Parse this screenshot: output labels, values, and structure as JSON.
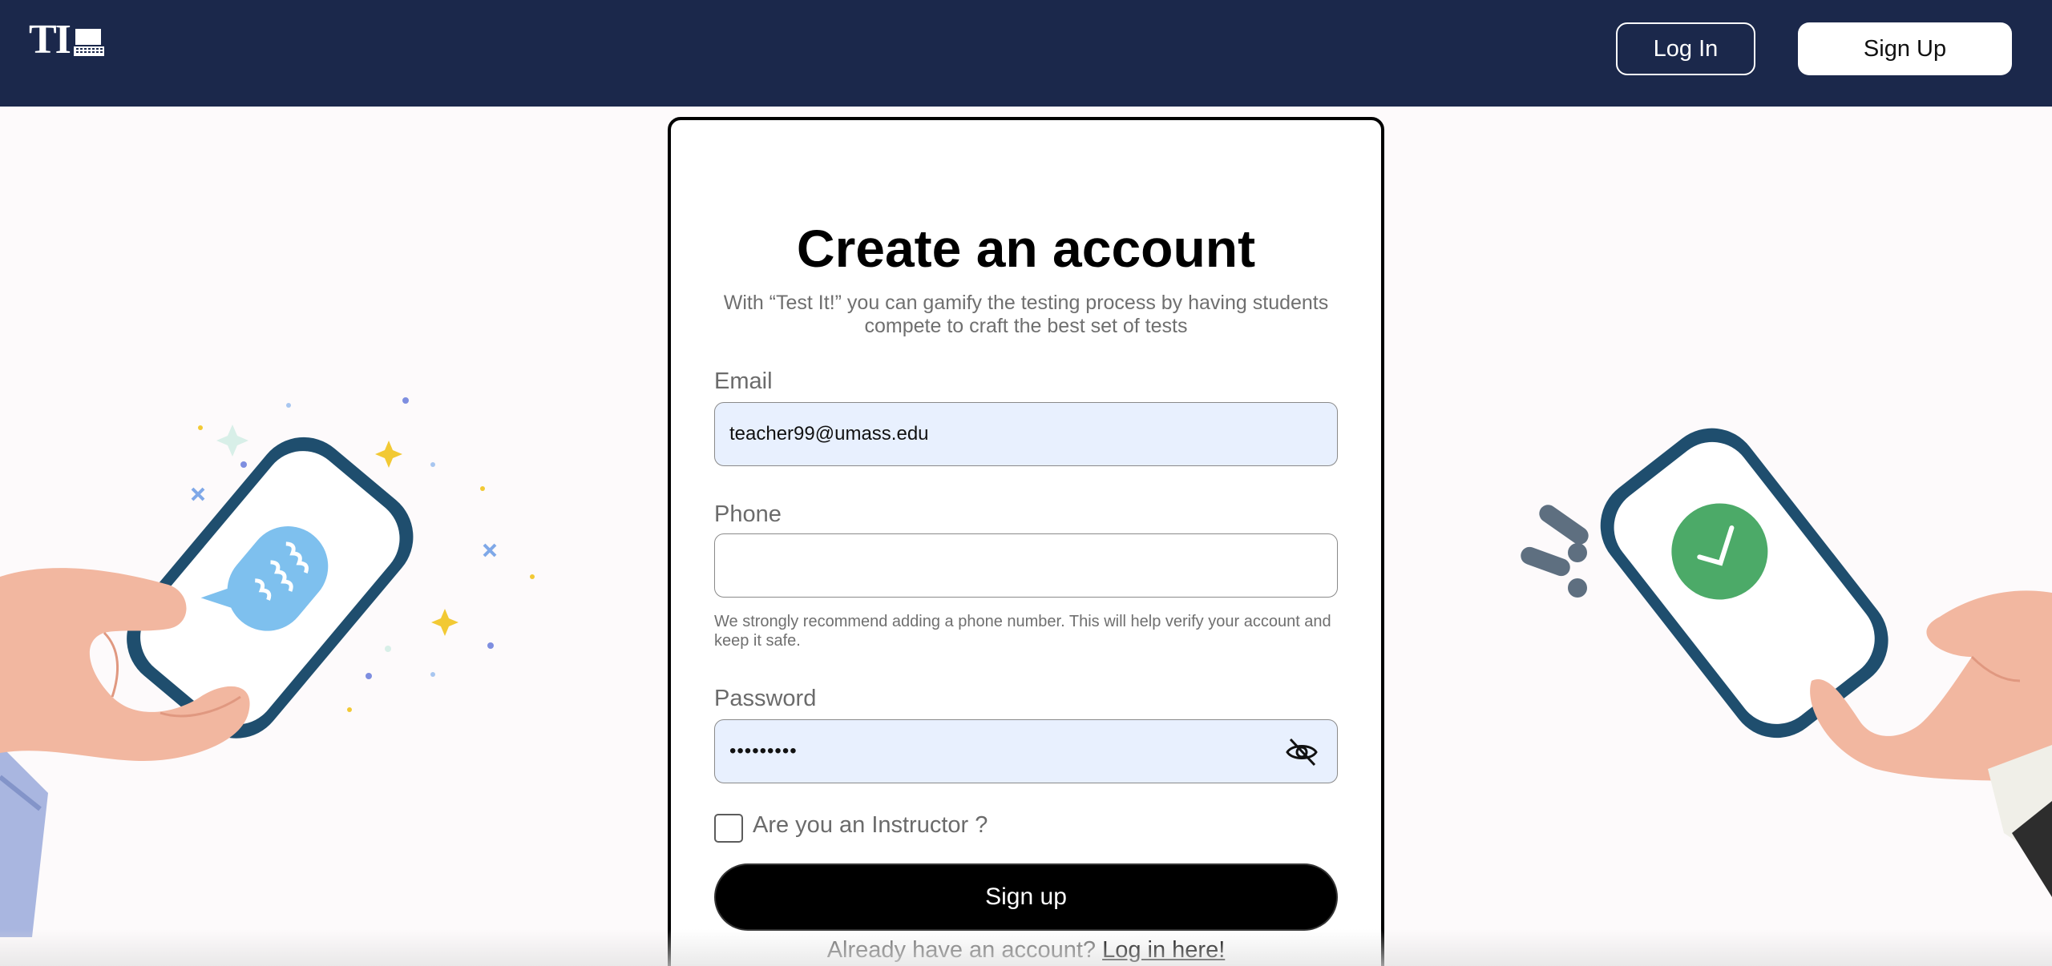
{
  "header": {
    "logo_text": "TI",
    "login_label": "Log In",
    "signup_label": "Sign Up"
  },
  "form": {
    "title": "Create an account",
    "subtitle": "With “Test It!” you can gamify the testing process by having students compete to craft the best set of tests",
    "email_label": "Email",
    "email_value": "teacher99@umass.edu",
    "phone_label": "Phone",
    "phone_value": "",
    "phone_hint": "We strongly recommend adding a phone number. This will help verify your account and keep it safe.",
    "password_label": "Password",
    "password_value": "•••••••••",
    "instructor_label": "Are you an Instructor ?",
    "submit_label": "Sign up",
    "already_text": "Already have an account? ",
    "login_link": "Log in here!"
  },
  "icons": {
    "logo": "laptop-icon",
    "password_toggle": "eye-slash-icon"
  },
  "colors": {
    "header_bg": "#1b284b",
    "field_filled_bg": "#e8f0fe",
    "primary_button": "#000000"
  }
}
